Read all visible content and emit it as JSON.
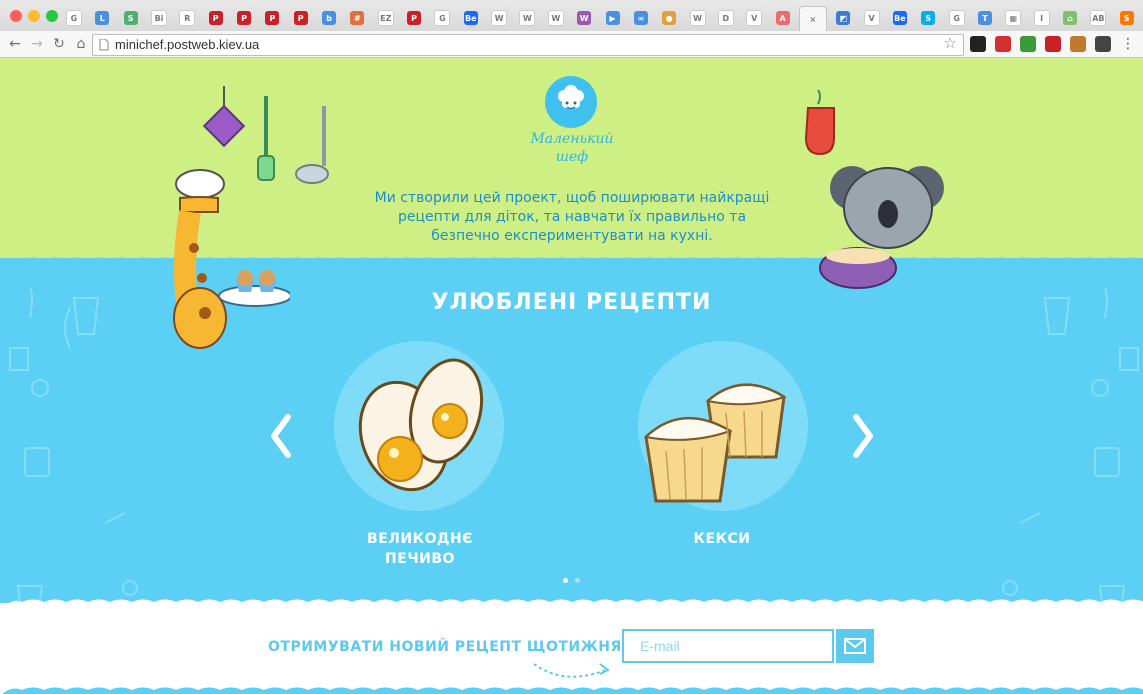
{
  "browser": {
    "url": "minichef.postweb.kiev.ua",
    "tabs": [
      {
        "icon": "google-tab-icon",
        "letter": "G",
        "color": "#ffffff"
      },
      {
        "icon": "blue-l-tab-icon",
        "letter": "L",
        "color": "#4a8fe0"
      },
      {
        "icon": "green-s-tab-icon",
        "letter": "S",
        "color": "#4fb06b"
      },
      {
        "icon": "bi-tab-icon",
        "letter": "Bi",
        "color": "#ffffff"
      },
      {
        "icon": "rss-tab-icon",
        "letter": "R",
        "color": "#ffffff"
      },
      {
        "icon": "pinterest-tab-icon",
        "letter": "P",
        "color": "#cb2027"
      },
      {
        "icon": "pinterest-tab-icon",
        "letter": "P",
        "color": "#cb2027"
      },
      {
        "icon": "pinterest-tab-icon",
        "letter": "P",
        "color": "#cb2027"
      },
      {
        "icon": "pinterest-tab-icon",
        "letter": "P",
        "color": "#cb2027"
      },
      {
        "icon": "bird-tab-icon",
        "letter": "b",
        "color": "#4a8fe0"
      },
      {
        "icon": "grid-tab-icon",
        "letter": "#",
        "color": "#e07040"
      },
      {
        "icon": "ez-tab-icon",
        "letter": "EZ",
        "color": "#ffffff"
      },
      {
        "icon": "pinterest-tab-icon",
        "letter": "P",
        "color": "#cb2027"
      },
      {
        "icon": "google-tab-icon",
        "letter": "G",
        "color": "#ffffff"
      },
      {
        "icon": "behance-tab-icon",
        "letter": "Be",
        "color": "#1769ff"
      },
      {
        "icon": "wikipedia-tab-icon",
        "letter": "W",
        "color": "#ffffff"
      },
      {
        "icon": "wikipedia-tab-icon",
        "letter": "W",
        "color": "#ffffff"
      },
      {
        "icon": "wikipedia-tab-icon",
        "letter": "W",
        "color": "#ffffff"
      },
      {
        "icon": "purple-tab-icon",
        "letter": "W",
        "color": "#9b59b6"
      },
      {
        "icon": "play-tab-icon",
        "letter": "▶",
        "color": "#4a8fe0"
      },
      {
        "icon": "link-tab-icon",
        "letter": "∞",
        "color": "#4a8fe0"
      },
      {
        "icon": "cookie-tab-icon",
        "letter": "●",
        "color": "#e0a040"
      },
      {
        "icon": "wikipedia-tab-icon",
        "letter": "W",
        "color": "#ffffff"
      },
      {
        "icon": "doc-tab-icon",
        "letter": "D",
        "color": "#ffffff"
      },
      {
        "icon": "v-tab-icon",
        "letter": "V",
        "color": "#ffffff"
      },
      {
        "icon": "asana-tab-icon",
        "letter": "A",
        "color": "#f06a6a"
      },
      {
        "icon": "active-tab-close-icon",
        "letter": "×",
        "color": "#ffffff",
        "active": true
      },
      {
        "icon": "image-tab-icon",
        "letter": "◩",
        "color": "#3a7bd5"
      },
      {
        "icon": "vimeo-tab-icon",
        "letter": "V",
        "color": "#ffffff"
      },
      {
        "icon": "behance-tab-icon",
        "letter": "Be",
        "color": "#1769ff"
      },
      {
        "icon": "skype-tab-icon",
        "letter": "S",
        "color": "#00aff0"
      },
      {
        "icon": "google-tab-icon",
        "letter": "G",
        "color": "#ffffff"
      },
      {
        "icon": "tag-tab-icon",
        "letter": "T",
        "color": "#4a8fe0"
      },
      {
        "icon": "pixel-tab-icon",
        "letter": "▦",
        "color": "#ffffff"
      },
      {
        "icon": "text-cursor-tab-icon",
        "letter": "I",
        "color": "#ffffff"
      },
      {
        "icon": "home-tab-icon",
        "letter": "⌂",
        "color": "#7ec06b"
      },
      {
        "icon": "avr-tab-icon",
        "letter": "AB",
        "color": "#ffffff"
      },
      {
        "icon": "soundcloud-tab-icon",
        "letter": "S",
        "color": "#ff7700"
      }
    ],
    "extensions": [
      {
        "icon": "horse-extension-icon",
        "color": "#222222"
      },
      {
        "icon": "adblock-extension-icon",
        "color": "#d03030"
      },
      {
        "icon": "grid-extension-icon",
        "color": "#3a9a3a"
      },
      {
        "icon": "pinterest-extension-icon",
        "color": "#cb2027"
      },
      {
        "icon": "dog-extension-icon",
        "color": "#c07a30"
      },
      {
        "icon": "pocket-extension-icon",
        "color": "#444444"
      },
      {
        "icon": "menu-icon",
        "color": "#555555"
      }
    ]
  },
  "site": {
    "logo_line1": "Маленький",
    "logo_line2": "шеф",
    "intro": "Ми створили цей проект, щоб поширювати найкращі рецепти для діток, та навчати їх правильно та безпечно експериментувати на кухні.",
    "section_title": "УЛЮБЛЕНІ РЕЦЕПТИ",
    "recipes": [
      {
        "title_line1": "ВЕЛИКОДНЄ",
        "title_line2": "ПЕЧИВО"
      },
      {
        "title_line1": "КЕКСИ",
        "title_line2": ""
      }
    ],
    "subscribe_label": "ОТРИМУВАТИ НОВИЙ РЕЦЕПТ ЩОТИЖНЯ",
    "email_placeholder": "E-mail"
  },
  "colors": {
    "hero_green": "#cdef83",
    "sky_blue": "#5bd0f4",
    "accent_blue": "#1f8fc8"
  }
}
